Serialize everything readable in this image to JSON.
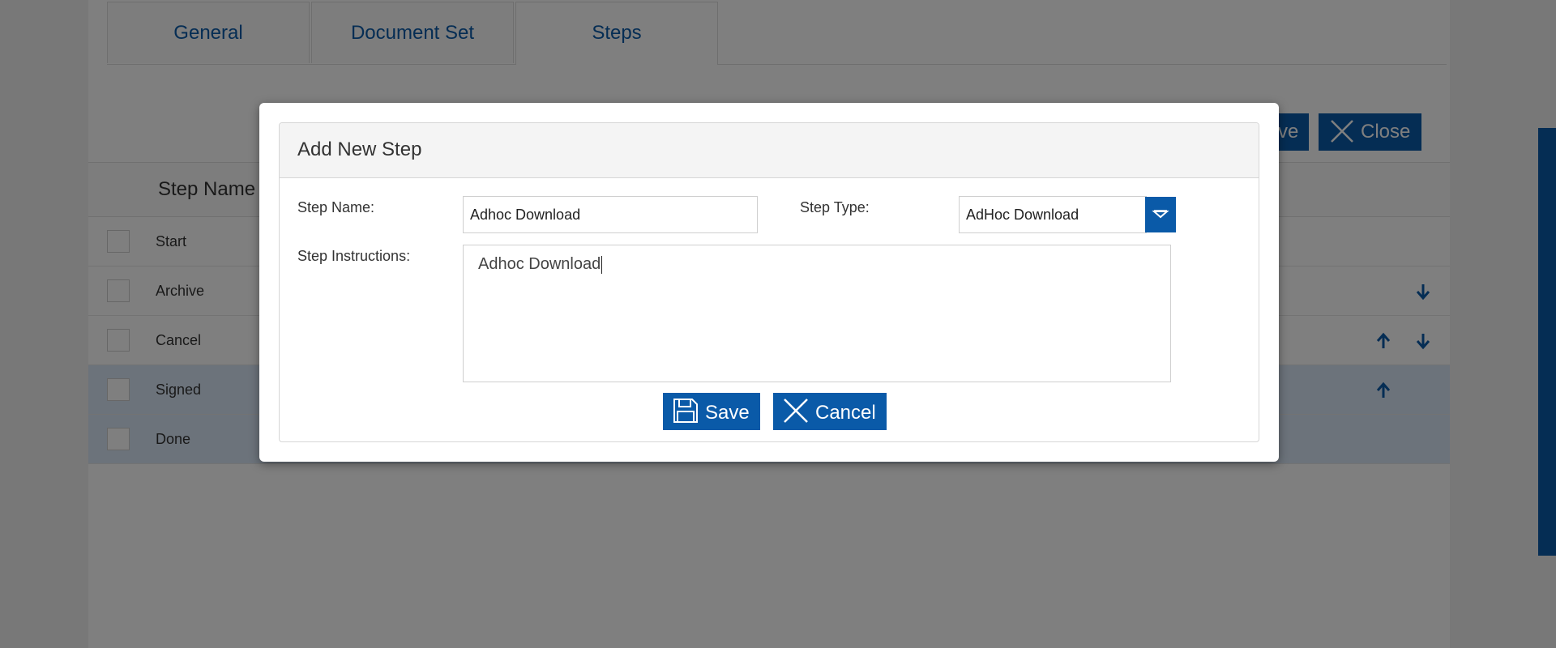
{
  "tabs": [
    {
      "label": "General"
    },
    {
      "label": "Document Set"
    },
    {
      "label": "Steps"
    }
  ],
  "header_buttons": {
    "save_partial": "ve",
    "close_label": "Close"
  },
  "table": {
    "column_header": "Step Name",
    "rows": [
      {
        "name": "Start"
      },
      {
        "name": "Archive"
      },
      {
        "name": "Cancel"
      },
      {
        "name": "Signed"
      },
      {
        "name": "Done"
      }
    ]
  },
  "modal": {
    "title": "Add New Step",
    "step_name_label": "Step Name:",
    "step_name_value": "Adhoc Download",
    "step_type_label": "Step Type:",
    "step_type_value": "AdHoc Download",
    "instructions_label": "Step Instructions:",
    "instructions_value": "Adhoc Download",
    "save_label": "Save",
    "cancel_label": "Cancel"
  },
  "colors": {
    "accent": "#0a5aa8",
    "highlight_row": "#d9e6f7"
  },
  "icons": {
    "save": "floppy-disk-icon",
    "cancel": "x-icon",
    "close": "x-icon",
    "move_up": "arrow-up-icon",
    "move_down": "arrow-down-icon",
    "dropdown": "triangle-down-icon"
  }
}
